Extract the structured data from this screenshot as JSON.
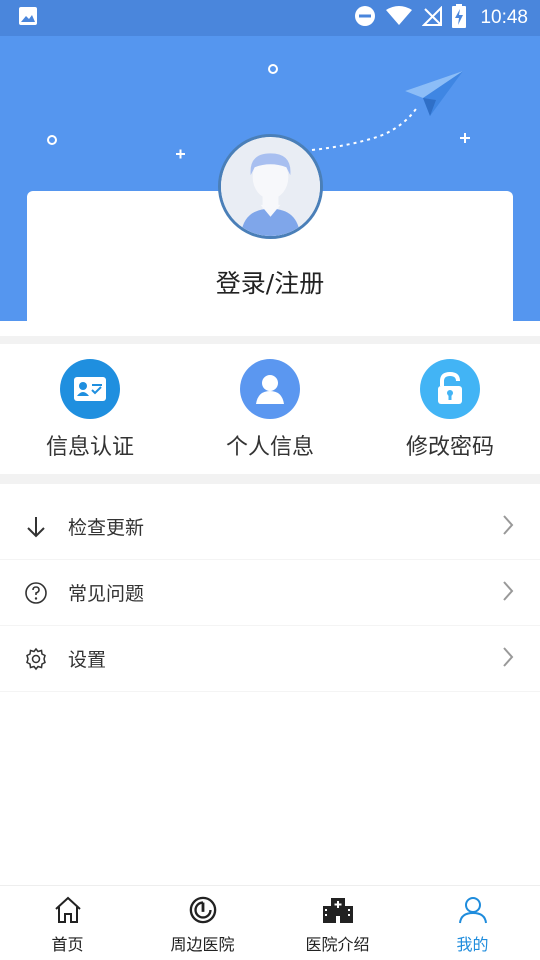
{
  "status_bar": {
    "time": "10:48",
    "icons": [
      "image-icon",
      "dnd-icon",
      "wifi-icon",
      "no-signal-icon",
      "battery-charging-icon"
    ]
  },
  "profile": {
    "login_label": "登录/注册",
    "avatar_icon": "avatar-icon"
  },
  "quick_actions": [
    {
      "label": "信息认证",
      "icon": "id-card-icon",
      "color": "#1f8fdf"
    },
    {
      "label": "个人信息",
      "icon": "user-icon",
      "color": "#5b97f0"
    },
    {
      "label": "修改密码",
      "icon": "unlock-icon",
      "color": "#42b4f5"
    }
  ],
  "menu": [
    {
      "label": "检查更新",
      "icon": "download-arrow-icon"
    },
    {
      "label": "常见问题",
      "icon": "question-icon"
    },
    {
      "label": "设置",
      "icon": "gear-icon"
    }
  ],
  "tabbar": [
    {
      "label": "首页",
      "icon": "home-icon",
      "active": false
    },
    {
      "label": "周边医院",
      "icon": "radar-icon",
      "active": false
    },
    {
      "label": "医院介绍",
      "icon": "hospital-icon",
      "active": false
    },
    {
      "label": "我的",
      "icon": "person-icon",
      "active": true
    }
  ],
  "colors": {
    "header_bg": "#5596ef",
    "status_bg": "#4a86dc",
    "active_tab": "#1f8cdc"
  }
}
